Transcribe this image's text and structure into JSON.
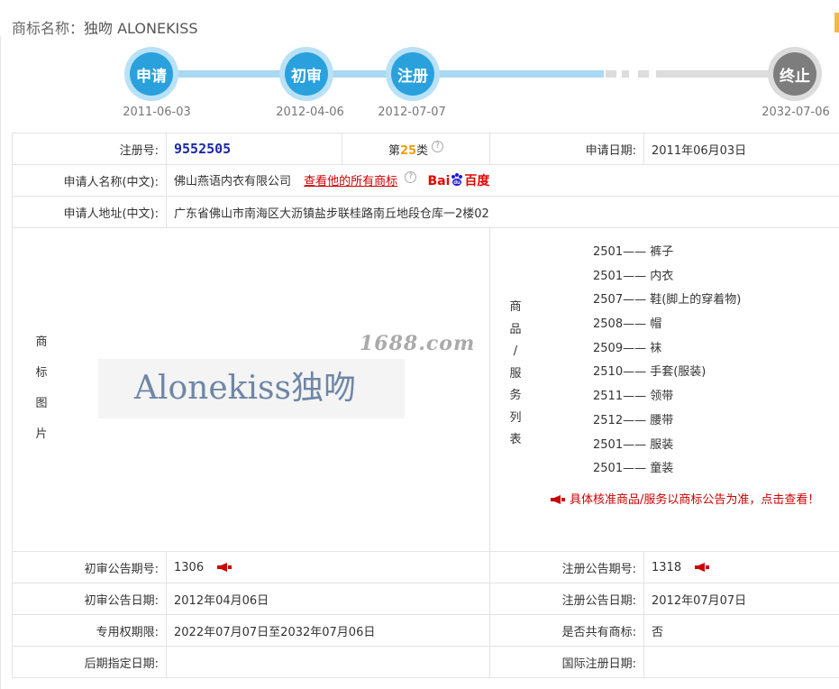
{
  "header": {
    "label": "商标名称：",
    "name": "独吻 ALONEKISS"
  },
  "timeline": [
    {
      "step": "申请",
      "date": "2011-06-03"
    },
    {
      "step": "初审",
      "date": "2012-04-06"
    },
    {
      "step": "注册",
      "date": "2012-07-07"
    },
    {
      "step": "终止",
      "date": "2032-07-06"
    }
  ],
  "info": {
    "reg_no_label": "注册号:",
    "reg_no": "9552505",
    "class_prefix": "第",
    "class_num": "25",
    "class_suffix": "类",
    "apply_date_label": "申请日期:",
    "apply_date": "2011年06月03日",
    "applicant_label": "申请人名称(中文):",
    "applicant": "佛山燕语内衣有限公司",
    "all_marks_link": "查看他的所有商标",
    "baidu_bai": "Bai",
    "baidu_du": "百度",
    "address_label": "申请人地址(中文):",
    "address": "广东省佛山市南海区大沥镇盐步联桂路南丘地段仓库一2楼02",
    "image_label": [
      "商",
      "标",
      "图",
      "片"
    ],
    "watermark": "1688.com",
    "logo_text": "Alonekiss独吻",
    "goods_label": [
      "商",
      "品",
      "/",
      "服",
      "务",
      "列",
      "表"
    ],
    "goods": [
      "2501—— 裤子",
      "2501—— 内衣",
      "2507—— 鞋(脚上的穿着物)",
      "2508—— 帽",
      "2509—— 袜",
      "2510—— 手套(服装)",
      "2511—— 领带",
      "2512—— 腰带",
      "2501—— 服装",
      "2501—— 童装"
    ],
    "goods_notice": "具体核准商品/服务以商标公告为准，点击查看！",
    "prelim_no_label": "初审公告期号:",
    "prelim_no": "1306",
    "reg_pub_no_label": "注册公告期号:",
    "reg_pub_no": "1318",
    "prelim_date_label": "初审公告日期:",
    "prelim_date": "2012年04月06日",
    "reg_pub_date_label": "注册公告日期:",
    "reg_pub_date": "2012年07月07日",
    "term_label": "专用权期限:",
    "term": "2022年07月07日至2032年07月06日",
    "shared_label": "是否共有商标:",
    "shared": "否",
    "later_label": "后期指定日期:",
    "later": "",
    "intl_label": "国际注册日期:",
    "intl": ""
  },
  "colors": {
    "step_blue": "#2aa1dc",
    "step_gray": "#7d7d7d",
    "link_red": "#cc0000",
    "reg_no": "#1b2aa6"
  }
}
